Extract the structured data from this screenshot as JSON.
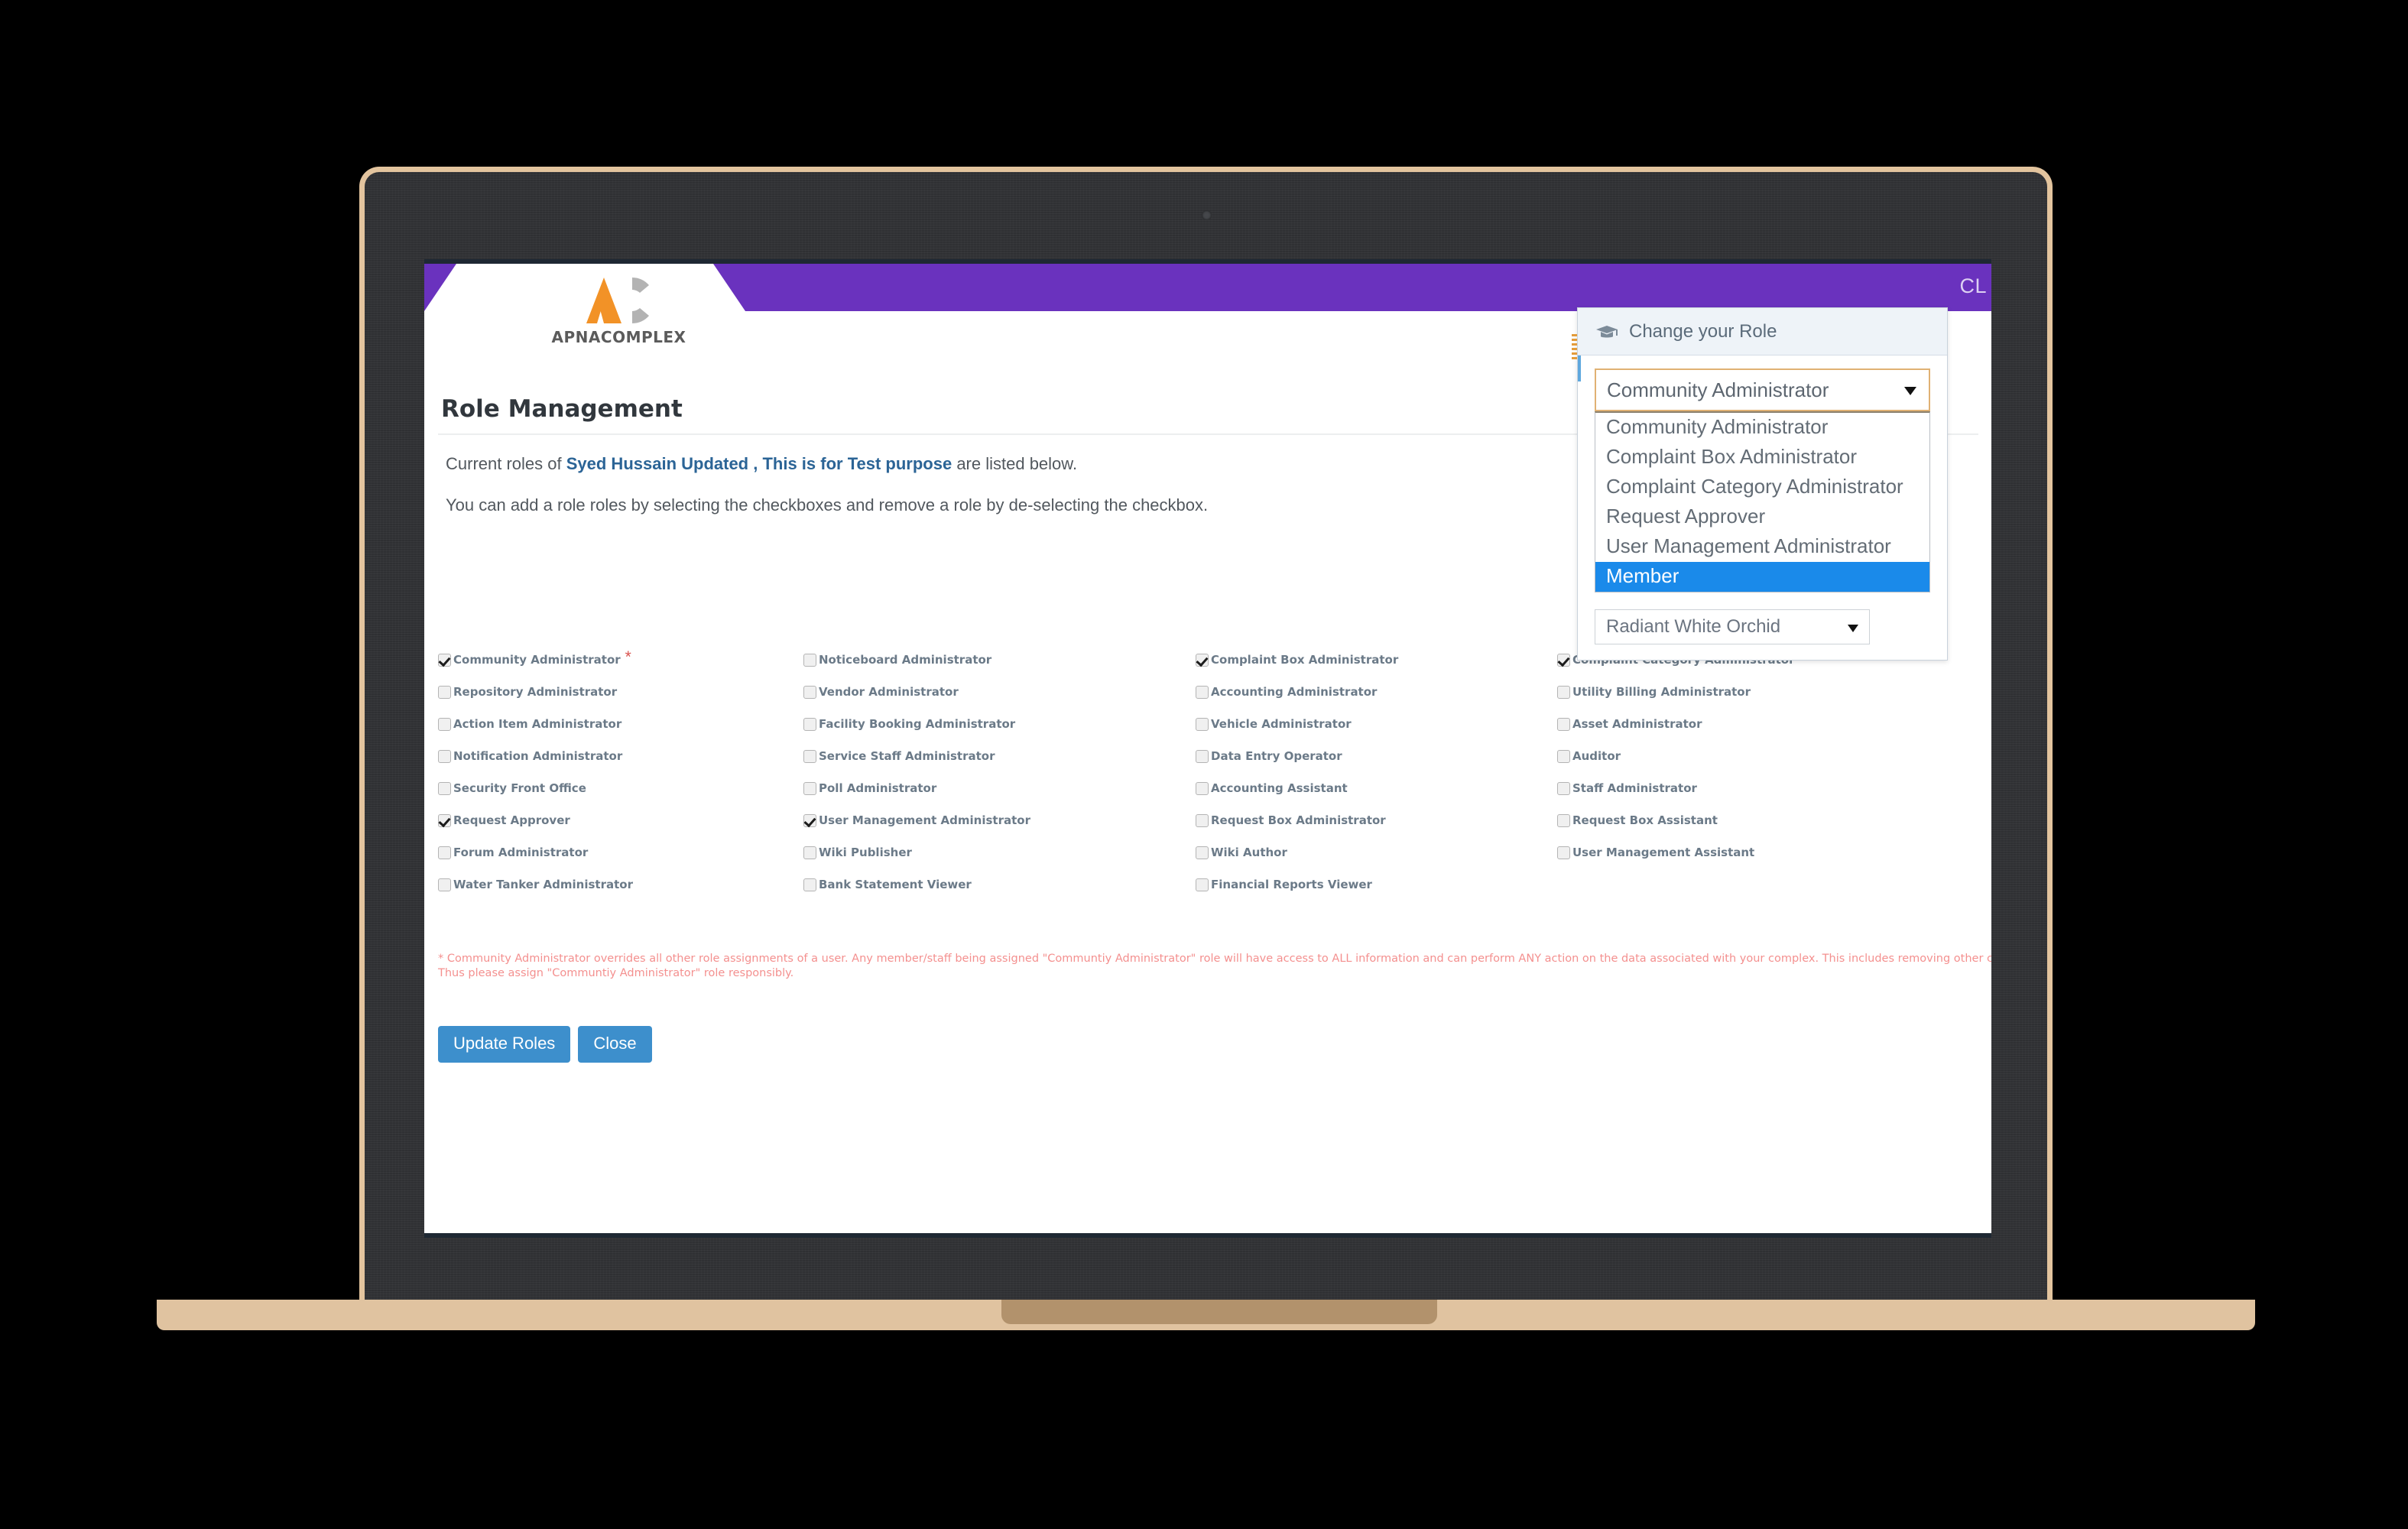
{
  "brand": {
    "logo_text": "APNACOMPLEX",
    "accent_purple": "#6a32be",
    "logo_orange": "#f29227",
    "logo_grey": "#b3b3b3"
  },
  "topbar": {
    "right_label": "CL"
  },
  "page": {
    "title": "Role Management",
    "lead_prefix": "Current roles of ",
    "lead_user": "Syed Hussain Updated , This is for Test purpose",
    "lead_suffix": " are listed below.",
    "lead2": "You can add a role roles by selecting the checkboxes and remove a role by de-selecting the checkbox.",
    "footnote": "* Community Administrator overrides all other role assignments of a user. Any member/staff being assigned \"Communtiy Administrator\" role will have access to ALL information and can perform ANY action on the data associated with your complex. This includes removing other community administrators as well. Thus please assign \"Communtiy Administrator\" role responsibly."
  },
  "roles": [
    {
      "label": "Community Administrator",
      "checked": true,
      "required_star": true
    },
    {
      "label": "Noticeboard Administrator",
      "checked": false,
      "required_star": false
    },
    {
      "label": "Complaint Box Administrator",
      "checked": true,
      "required_star": false
    },
    {
      "label": "Complaint Category Administrator",
      "checked": true,
      "required_star": false
    },
    {
      "label": "Repository Administrator",
      "checked": false,
      "required_star": false
    },
    {
      "label": "Vendor Administrator",
      "checked": false,
      "required_star": false
    },
    {
      "label": "Accounting Administrator",
      "checked": false,
      "required_star": false
    },
    {
      "label": "Utility Billing Administrator",
      "checked": false,
      "required_star": false
    },
    {
      "label": "Action Item Administrator",
      "checked": false,
      "required_star": false
    },
    {
      "label": "Facility Booking Administrator",
      "checked": false,
      "required_star": false
    },
    {
      "label": "Vehicle Administrator",
      "checked": false,
      "required_star": false
    },
    {
      "label": "Asset Administrator",
      "checked": false,
      "required_star": false
    },
    {
      "label": "Notification Administrator",
      "checked": false,
      "required_star": false
    },
    {
      "label": "Service Staff Administrator",
      "checked": false,
      "required_star": false
    },
    {
      "label": "Data Entry Operator",
      "checked": false,
      "required_star": false
    },
    {
      "label": "Auditor",
      "checked": false,
      "required_star": false
    },
    {
      "label": "Security Front Office",
      "checked": false,
      "required_star": false
    },
    {
      "label": "Poll Administrator",
      "checked": false,
      "required_star": false
    },
    {
      "label": "Accounting Assistant",
      "checked": false,
      "required_star": false
    },
    {
      "label": "Staff Administrator",
      "checked": false,
      "required_star": false
    },
    {
      "label": "Request Approver",
      "checked": true,
      "required_star": false
    },
    {
      "label": "User Management Administrator",
      "checked": true,
      "required_star": false
    },
    {
      "label": "Request Box Administrator",
      "checked": false,
      "required_star": false
    },
    {
      "label": "Request Box Assistant",
      "checked": false,
      "required_star": false
    },
    {
      "label": "Forum Administrator",
      "checked": false,
      "required_star": false
    },
    {
      "label": "Wiki Publisher",
      "checked": false,
      "required_star": false
    },
    {
      "label": "Wiki Author",
      "checked": false,
      "required_star": false
    },
    {
      "label": "User Management Assistant",
      "checked": false,
      "required_star": false
    },
    {
      "label": "Water Tanker Administrator",
      "checked": false,
      "required_star": false
    },
    {
      "label": "Bank Statement Viewer",
      "checked": false,
      "required_star": false
    },
    {
      "label": "Financial Reports Viewer",
      "checked": false,
      "required_star": false
    },
    {
      "label": "",
      "checked": false,
      "required_star": false
    }
  ],
  "buttons": {
    "update_roles": "Update Roles",
    "close": "Close"
  },
  "popover": {
    "title": "Change your Role",
    "selected_role": "Community Administrator",
    "options": [
      {
        "label": "Community Administrator",
        "selected": false
      },
      {
        "label": "Complaint Box Administrator",
        "selected": false
      },
      {
        "label": "Complaint Category Administrator",
        "selected": false
      },
      {
        "label": "Request Approver",
        "selected": false
      },
      {
        "label": "User Management Administrator",
        "selected": false
      },
      {
        "label": "Member",
        "selected": true
      }
    ],
    "theme_selected": "Radiant White Orchid",
    "highlight_color": "#1a8aea"
  }
}
